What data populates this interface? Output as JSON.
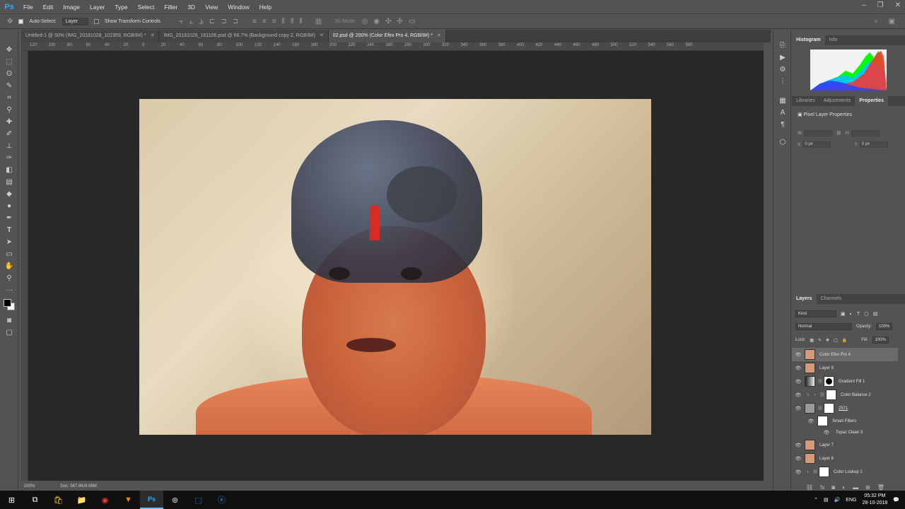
{
  "app": {
    "logo": "Ps"
  },
  "menu": [
    "File",
    "Edit",
    "Image",
    "Layer",
    "Type",
    "Select",
    "Filter",
    "3D",
    "View",
    "Window",
    "Help"
  ],
  "window_controls": [
    "–",
    "❐",
    "✕"
  ],
  "options_bar": {
    "auto_select_label": "Auto-Select:",
    "auto_select_target": "Layer",
    "transform_controls_label": "Show Transform Controls",
    "mode_3d_label": "3D Mode:"
  },
  "tabs": [
    {
      "label": "Untitled-1 @ 50% (IMG_20181028_101959, RGB/8#) *"
    },
    {
      "label": "IMG_20181026_161106.psd @ 66.7% (Background copy 2, RGB/8#)"
    },
    {
      "label": "02.psd @ 200% (Color Efex Pro 4, RGB/8#) *"
    }
  ],
  "ruler_ticks": [
    "120",
    "100",
    "80",
    "60",
    "40",
    "20",
    "0",
    "20",
    "40",
    "60",
    "80",
    "100",
    "120",
    "140",
    "160",
    "180",
    "200",
    "220",
    "240",
    "260",
    "280",
    "300",
    "320",
    "340",
    "360",
    "380",
    "400",
    "420",
    "440",
    "460",
    "480",
    "500",
    "520",
    "540",
    "560",
    "580"
  ],
  "status": {
    "zoom": "200%",
    "doc_size": "Doc: 567.9K/9.08M"
  },
  "histogram_panel": {
    "tabs": [
      "Histogram",
      "Info"
    ]
  },
  "properties_panel": {
    "tabs": [
      "Libraries",
      "Adjustments",
      "Properties"
    ],
    "header": "Pixel Layer Properties",
    "w_label": "W:",
    "h_label": "H:",
    "x_label": "X:",
    "y_label": "Y:",
    "x_value": "0 px",
    "y_value": "0 px"
  },
  "layers_panel": {
    "tabs": [
      "Layers",
      "Channels"
    ],
    "filter_kind": "Kind",
    "blend_mode": "Normal",
    "opacity_label": "Opacity:",
    "opacity_value": "100%",
    "lock_label": "Lock:",
    "fill_label": "Fill:",
    "fill_value": "100%",
    "layers": [
      {
        "name": "Color Efex Pro 4",
        "thumb": "photo",
        "selected": true
      },
      {
        "name": "Layer 8",
        "thumb": "photo"
      },
      {
        "name": "Gradient Fill 1",
        "thumb": "grey",
        "mask": "black"
      },
      {
        "name": "Color Balance 2",
        "thumb": "adjust",
        "mask": "white"
      },
      {
        "name": "2571",
        "thumb": "smart",
        "mask": "white"
      },
      {
        "name": "Smart Filters",
        "thumb": "white",
        "indent": true
      },
      {
        "name": "Topaz Clean 3",
        "indent": true,
        "sub": true
      },
      {
        "name": "Layer 7",
        "thumb": "photo"
      },
      {
        "name": "Layer 6",
        "thumb": "photo"
      },
      {
        "name": "Color Lookup 1",
        "thumb": "adjust",
        "mask": "white"
      }
    ]
  },
  "taskbar": {
    "lang": "ENG",
    "time": "05:32 PM",
    "date": "28-10-2018"
  },
  "colors": {
    "ps_blue": "#31a8ff",
    "panel_bg": "#535353",
    "canvas_bg": "#282828",
    "taskbar_bg": "#101010"
  }
}
